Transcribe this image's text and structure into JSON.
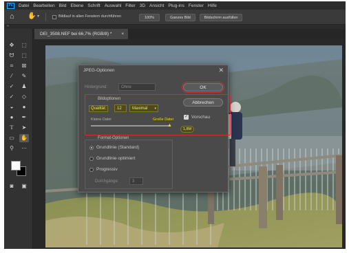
{
  "menu": [
    "Datei",
    "Bearbeiten",
    "Bild",
    "Ebene",
    "Schrift",
    "Auswahl",
    "Filter",
    "3D",
    "Ansicht",
    "Plug-ins",
    "Fenster",
    "Hilfe"
  ],
  "app_logo": "Ps",
  "options_bar": {
    "scroll_all_label": "Bildlauf in allen Fenstern durchführen",
    "zoom_100": "100%",
    "fit_screen": "Ganzes Bild",
    "fill_screen": "Bildschirm ausfüllen"
  },
  "document_tab": {
    "title": "DEI_3508.NEF bei 66,7% (RGB/8) *",
    "close": "×"
  },
  "dialog": {
    "title": "JPEG-Optionen",
    "matte_label": "Hintergrund:",
    "matte_value": "Ohne",
    "ok_label": "OK",
    "cancel_label": "Abbrechen",
    "image_options_label": "Bildoptionen",
    "quality_label": "Qualität:",
    "quality_value": "12",
    "quality_preset": "Maximal",
    "small_file_label": "Kleine Datei",
    "large_file_label": "Große Datei",
    "quality_slider_fraction": 1.0,
    "preview_label": "Vorschau",
    "preview_checked": true,
    "size_readout": "1,8M",
    "format_options_label": "Format-Optionen",
    "format_options": [
      {
        "label": "Grundlinie (Standard)",
        "selected": true
      },
      {
        "label": "Grundlinie optimiert",
        "selected": false
      },
      {
        "label": "Progressiv",
        "selected": false
      }
    ],
    "scans_label": "Durchgänge:",
    "scans_value": "3"
  },
  "colors": {
    "highlight_box": "#d42a3c",
    "yellow_marker": "#e6e030",
    "ps_blue": "#31a8ff"
  }
}
